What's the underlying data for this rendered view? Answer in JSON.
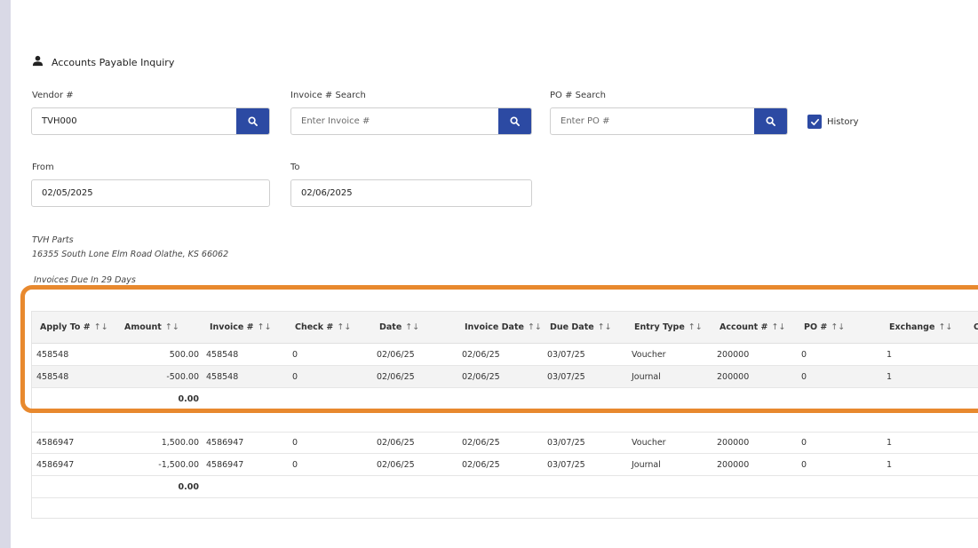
{
  "page": {
    "title": "Accounts Payable Inquiry"
  },
  "filters": {
    "vendor": {
      "label": "Vendor #",
      "value": "TVH000"
    },
    "invoice": {
      "label": "Invoice # Search",
      "placeholder": "Enter Invoice #"
    },
    "po": {
      "label": "PO # Search",
      "placeholder": "Enter PO #"
    },
    "history": {
      "label": "History",
      "checked": true
    },
    "from": {
      "label": "From",
      "value": "02/05/2025"
    },
    "to": {
      "label": "To",
      "value": "02/06/2025"
    }
  },
  "vendor_info": {
    "name": "TVH Parts",
    "address": "16355 South Lone Elm Road Olathe, KS 66062"
  },
  "due_note": "Invoices Due In 29 Days",
  "table": {
    "columns": [
      "Apply To #",
      "Amount",
      "Invoice #",
      "Check #",
      "Date",
      "Invoice Date",
      "Due Date",
      "Entry Type",
      "Account #",
      "PO #",
      "Exchange",
      "C"
    ],
    "sort_glyph": "↑↓",
    "groups": [
      {
        "rows": [
          {
            "apply_to": "458548",
            "amount": "500.00",
            "invoice": "458548",
            "check": "0",
            "date": "02/06/25",
            "invoice_date": "02/06/25",
            "due_date": "03/07/25",
            "entry_type": "Voucher",
            "account": "200000",
            "po": "0",
            "exchange": "1"
          },
          {
            "apply_to": "458548",
            "amount": "-500.00",
            "invoice": "458548",
            "check": "0",
            "date": "02/06/25",
            "invoice_date": "02/06/25",
            "due_date": "03/07/25",
            "entry_type": "Journal",
            "account": "200000",
            "po": "0",
            "exchange": "1"
          }
        ],
        "total": "0.00"
      },
      {
        "rows": [
          {
            "apply_to": "4586947",
            "amount": "1,500.00",
            "invoice": "4586947",
            "check": "0",
            "date": "02/06/25",
            "invoice_date": "02/06/25",
            "due_date": "03/07/25",
            "entry_type": "Voucher",
            "account": "200000",
            "po": "0",
            "exchange": "1"
          },
          {
            "apply_to": "4586947",
            "amount": "-1,500.00",
            "invoice": "4586947",
            "check": "0",
            "date": "02/06/25",
            "invoice_date": "02/06/25",
            "due_date": "03/07/25",
            "entry_type": "Journal",
            "account": "200000",
            "po": "0",
            "exchange": "1"
          }
        ],
        "total": "0.00"
      }
    ]
  },
  "colors": {
    "accent": "#2c4aa3",
    "highlight": "#e8892e"
  },
  "icons": {
    "title": "user-icon",
    "search": "search-icon",
    "check": "checkmark-icon"
  }
}
